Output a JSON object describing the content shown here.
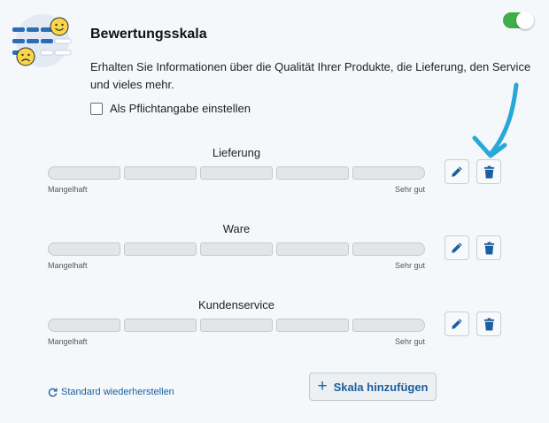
{
  "header": {
    "title": "Bewertungsskala",
    "app_icon": "rating-scale-smiley-icon",
    "enabled": true
  },
  "description": "Erhalten Sie Informationen über die Qualität Ihrer Produkte, die Lieferung, den Service und vieles mehr.",
  "required_label": "Als Pflichtangabe einstellen",
  "required_checked": false,
  "scales": [
    {
      "label": "Lieferung",
      "min_label": "Mangelhaft",
      "max_label": "Sehr gut",
      "segments": 5
    },
    {
      "label": "Ware",
      "min_label": "Mangelhaft",
      "max_label": "Sehr gut",
      "segments": 5
    },
    {
      "label": "Kundenservice",
      "min_label": "Mangelhaft",
      "max_label": "Sehr gut",
      "segments": 5
    }
  ],
  "row_actions": {
    "edit_icon": "pencil-icon",
    "delete_icon": "trash-icon"
  },
  "reset_link": "Standard wiederherstellen",
  "add_button": "Skala hinzufügen",
  "colors": {
    "accent": "#1b5fa0",
    "toggle_on": "#3fae49",
    "annotation_arrow": "#29a8d8"
  }
}
